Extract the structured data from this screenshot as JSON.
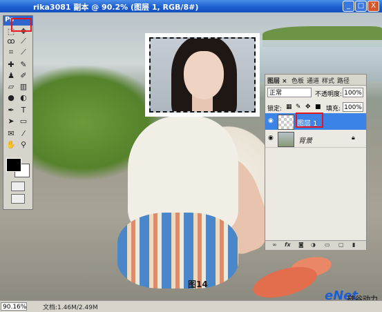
{
  "window": {
    "title": "rika3081 副本 @ 90.2% (图层 1, RGB/8#)",
    "buttons": [
      "_",
      "□",
      "X"
    ]
  },
  "tools": {
    "app_label": "Ps",
    "icons": [
      "marquee-icon",
      "move-icon",
      "lasso-icon",
      "magic-wand-icon",
      "crop-icon",
      "slice-icon",
      "healing-icon",
      "brush-icon",
      "stamp-icon",
      "history-brush-icon",
      "eraser-icon",
      "gradient-icon",
      "blur-icon",
      "dodge-icon",
      "pen-icon",
      "type-icon",
      "path-select-icon",
      "shape-icon",
      "notes-icon",
      "eyedropper-icon",
      "hand-icon",
      "zoom-icon"
    ],
    "fg_color": "#000000",
    "bg_color": "#ffffff"
  },
  "layers_panel": {
    "tabs": [
      "图层 ×",
      "色板",
      "通道",
      "样式",
      "路径"
    ],
    "blend_mode": "正常",
    "opacity_label": "不透明度:",
    "opacity_value": "100%",
    "lock_label": "锁定:",
    "fill_label": "填充:",
    "fill_value": "100%",
    "layers": [
      {
        "name": "图层 1",
        "selected": true
      },
      {
        "name": "背景",
        "selected": false
      }
    ],
    "bottom_icons": [
      "link-icon",
      "fx-icon",
      "mask-icon",
      "adjustment-icon",
      "group-icon",
      "new-layer-icon",
      "trash-icon"
    ]
  },
  "canvas": {
    "figure_label": "图14"
  },
  "status": {
    "zoom": "90.16%",
    "doc_info": "文档:1.46M/2.49M"
  },
  "watermark": {
    "brand": "eNet",
    "sub": "硅谷动力"
  },
  "colors": {
    "accent": "#3b83e6",
    "highlight": "#e3161e"
  }
}
